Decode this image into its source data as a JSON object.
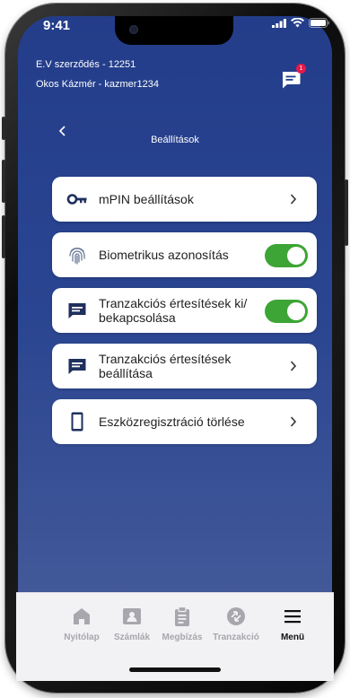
{
  "status": {
    "time": "9:41"
  },
  "header": {
    "contract": "E.V szerződés - 12251",
    "user": "Okos Kázmér - kazmer1234",
    "badge": "1"
  },
  "page": {
    "title": "Beállítások"
  },
  "items": [
    {
      "label": "mPIN beállítások",
      "icon": "key-icon",
      "control": "chevron"
    },
    {
      "label": "Biometrikus azonosítás",
      "icon": "fingerprint-icon",
      "control": "toggle",
      "on": true
    },
    {
      "label": "Tranzakciós értesítések ki/ bekapcsolása",
      "icon": "message-icon",
      "control": "toggle",
      "on": true
    },
    {
      "label": "Tranzakciós értesítések beállítása",
      "icon": "message-icon",
      "control": "chevron"
    },
    {
      "label": "Eszközregisztráció törlése",
      "icon": "phone-icon",
      "control": "chevron"
    }
  ],
  "tabs": [
    {
      "label": "Nyitólap",
      "icon": "home-icon"
    },
    {
      "label": "Számlák",
      "icon": "account-icon"
    },
    {
      "label": "Megbízás",
      "icon": "clipboard-icon"
    },
    {
      "label": "Tranzakció",
      "icon": "transfer-icon"
    },
    {
      "label": "Menü",
      "icon": "menu-icon",
      "active": true
    }
  ],
  "colors": {
    "background_top": "#233d8a",
    "background_bottom": "#4a5f9c",
    "toggle_on": "#3da535",
    "badge": "#e8194a"
  }
}
